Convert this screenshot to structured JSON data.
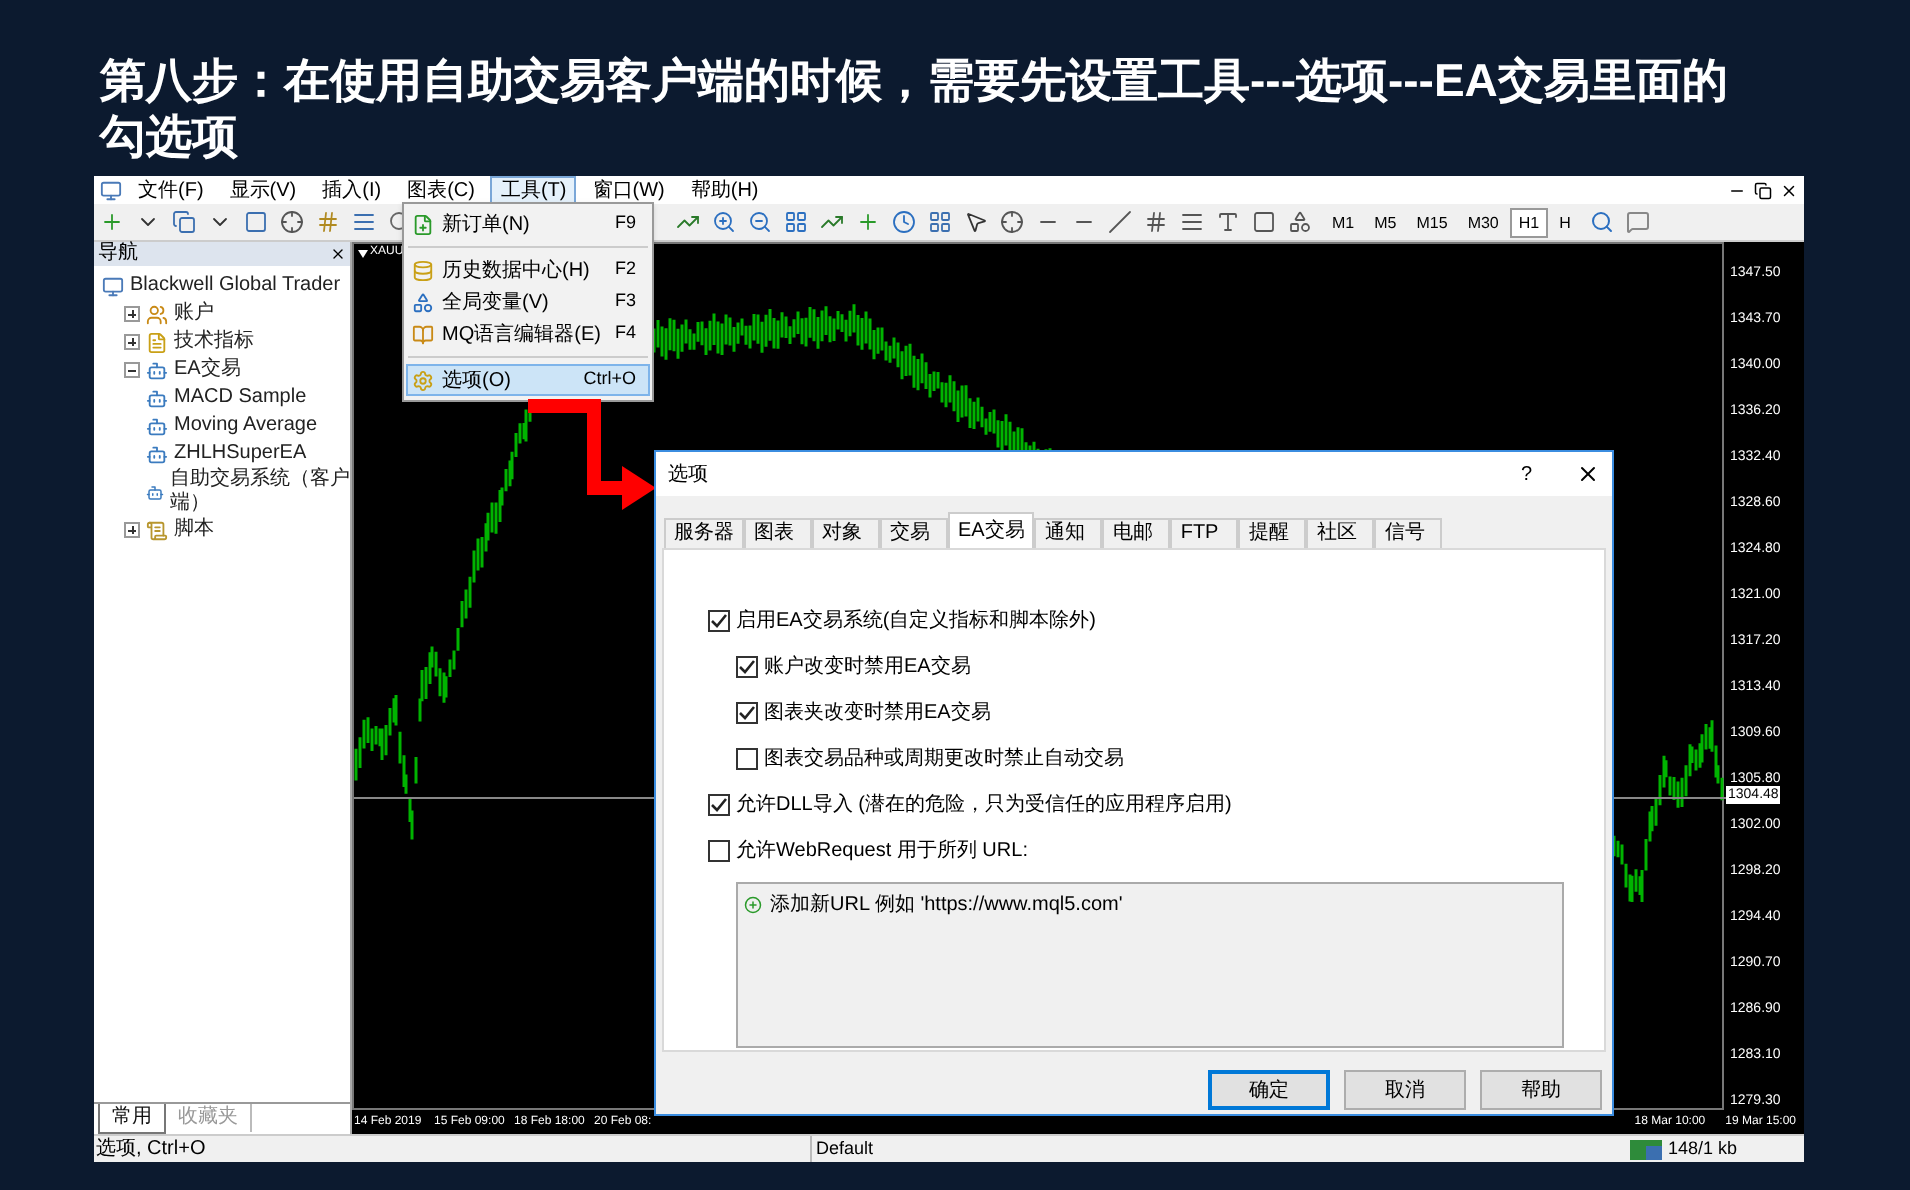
{
  "slide_title": "第八步：在使用自助交易客户端的时候，需要先设置工具---选项---EA交易里面的勾选项",
  "menubar": [
    {
      "label": "文件(F)",
      "selected": false
    },
    {
      "label": "显示(V)",
      "selected": false
    },
    {
      "label": "插入(I)",
      "selected": false
    },
    {
      "label": "图表(C)",
      "selected": false
    },
    {
      "label": "工具(T)",
      "selected": true
    },
    {
      "label": "窗口(W)",
      "selected": false
    },
    {
      "label": "帮助(H)",
      "selected": false
    }
  ],
  "toolbar": {
    "timeframes": [
      {
        "label": "M1",
        "selected": false
      },
      {
        "label": "M5",
        "selected": false
      },
      {
        "label": "M15",
        "selected": false
      },
      {
        "label": "M30",
        "selected": false
      },
      {
        "label": "H1",
        "selected": true
      },
      {
        "label": "H",
        "selected": false
      }
    ]
  },
  "navigator": {
    "title": "导航",
    "tree": [
      {
        "label": "Blackwell Global Trader",
        "kind": "terminal",
        "children": [
          {
            "label": "账户",
            "kind": "accounts",
            "expanded": false
          },
          {
            "label": "技术指标",
            "kind": "indicators",
            "expanded": false
          },
          {
            "label": "EA交易",
            "kind": "experts",
            "expanded": true,
            "children": [
              {
                "label": "MACD Sample",
                "kind": "expert"
              },
              {
                "label": "Moving Average",
                "kind": "expert"
              },
              {
                "label": "ZHLHSuperEA",
                "kind": "expert"
              },
              {
                "label": "自助交易系统（客户端）",
                "kind": "expert"
              }
            ]
          },
          {
            "label": "脚本",
            "kind": "scripts",
            "expanded": false
          }
        ]
      }
    ],
    "tabs": [
      {
        "label": "常用",
        "selected": true
      },
      {
        "label": "收藏夹",
        "selected": false
      }
    ]
  },
  "chart": {
    "symbol": "XAUU",
    "current_price": "1304.48",
    "price_labels": [
      "1347.50",
      "1343.70",
      "1340.00",
      "1336.20",
      "1332.40",
      "1328.60",
      "1324.80",
      "1321.00",
      "1317.20",
      "1313.40",
      "1309.60",
      "1305.80",
      "1302.00",
      "1298.20",
      "1294.40",
      "1290.70",
      "1286.90",
      "1283.10",
      "1279.30"
    ],
    "time_labels_left": [
      "14 Feb 2019",
      "15 Feb 09:00",
      "18 Feb 18:00",
      "20 Feb 08:"
    ],
    "time_labels_right": [
      "18 Mar 10:00",
      "19 Mar 15:00"
    ]
  },
  "tools_menu": [
    {
      "kind": "item",
      "label": "新订单(N)",
      "shortcut": "F9",
      "selected": false
    },
    {
      "kind": "separator"
    },
    {
      "kind": "item",
      "label": "历史数据中心(H)",
      "shortcut": "F2",
      "selected": false
    },
    {
      "kind": "item",
      "label": "全局变量(V)",
      "shortcut": "F3",
      "selected": false
    },
    {
      "kind": "item",
      "label": "MQ语言编辑器(E)",
      "shortcut": "F4",
      "selected": false
    },
    {
      "kind": "separator"
    },
    {
      "kind": "item",
      "label": "选项(O)",
      "shortcut": "Ctrl+O",
      "selected": true
    }
  ],
  "dialog": {
    "title": "选项",
    "help": "?",
    "tabs": [
      {
        "label": "服务器",
        "selected": false
      },
      {
        "label": "图表",
        "selected": false
      },
      {
        "label": "对象",
        "selected": false
      },
      {
        "label": "交易",
        "selected": false
      },
      {
        "label": "EA交易",
        "selected": true
      },
      {
        "label": "通知",
        "selected": false
      },
      {
        "label": "电邮",
        "selected": false
      },
      {
        "label": "FTP",
        "selected": false
      },
      {
        "label": "提醒",
        "selected": false
      },
      {
        "label": "社区",
        "selected": false
      },
      {
        "label": "信号",
        "selected": false
      }
    ],
    "options": [
      {
        "label": "启用EA交易系统(自定义指标和脚本除外)",
        "checked": true,
        "children": [
          {
            "label": "账户改变时禁用EA交易",
            "checked": true
          },
          {
            "label": "图表夹改变时禁用EA交易",
            "checked": true
          },
          {
            "label": "图表交易品种或周期更改时禁止自动交易",
            "checked": false
          }
        ]
      },
      {
        "label": "允许DLL导入 (潜在的危险，只为受信任的应用程序启用)",
        "checked": true
      },
      {
        "label": "允许WebRequest 用于所列 URL:",
        "checked": false
      }
    ],
    "url_list": [
      "添加新URL 例如 'https://www.mql5.com'"
    ],
    "buttons": [
      {
        "label": "确定",
        "default": true
      },
      {
        "label": "取消",
        "default": false
      },
      {
        "label": "帮助",
        "default": false
      }
    ]
  },
  "status_bar": {
    "hint": "选项, Ctrl+O",
    "profile": "Default",
    "traffic": "148/1 kb"
  }
}
